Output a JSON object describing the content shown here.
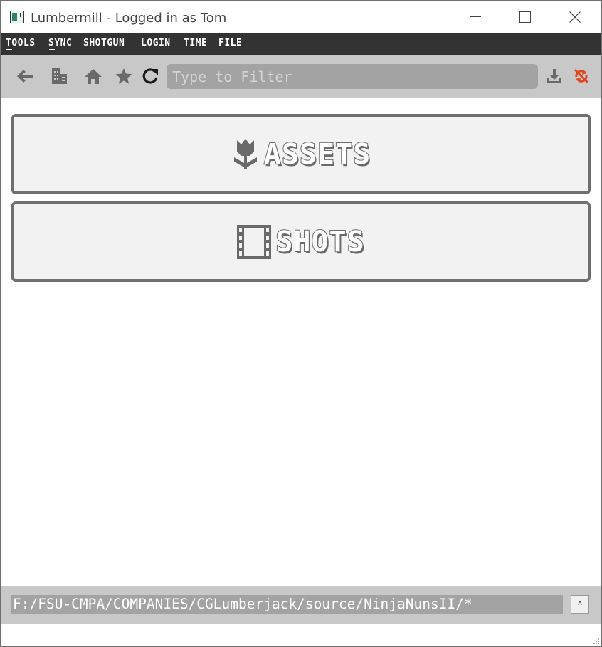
{
  "window": {
    "title": "Lumbermill - Logged in as Tom"
  },
  "menu": {
    "items": [
      "TOOLS",
      "SYNC",
      "SHOTGUN",
      "LOGIN",
      "TIME",
      "FILE"
    ]
  },
  "toolbar": {
    "filter_placeholder": "Type to Filter",
    "icons": [
      "back-arrow-icon",
      "building-icon",
      "home-icon",
      "star-icon",
      "refresh-icon",
      "download-icon",
      "sync-disabled-icon"
    ],
    "sync_color": "#e0461e"
  },
  "main": {
    "buttons": [
      {
        "label": "ASSETS",
        "icon": "tulip-icon"
      },
      {
        "label": "SHOTS",
        "icon": "film-strip-icon"
      }
    ]
  },
  "footer": {
    "path": "F:/FSU-CMPA/COMPANIES/CGLumberjack/source/NinjaNunsII/*",
    "up_button": "^"
  }
}
